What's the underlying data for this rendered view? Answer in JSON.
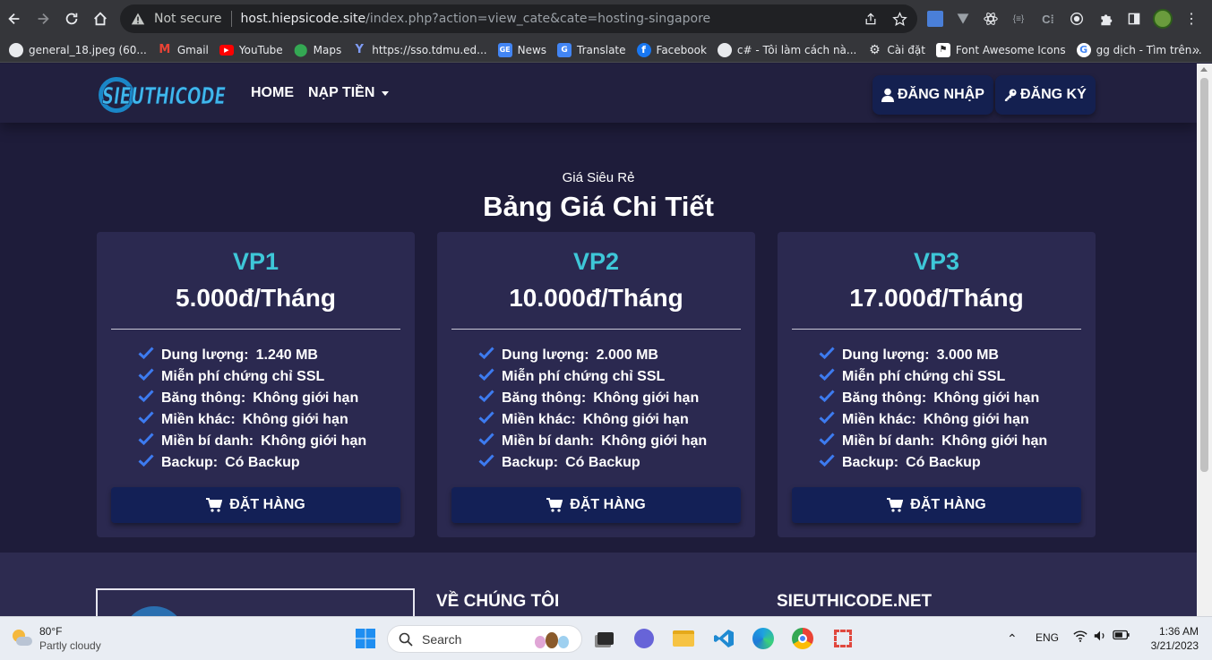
{
  "browser": {
    "security_label": "Not secure",
    "url_host": "host.hiepsicode.site",
    "url_path": "/index.php?action=view_cate&cate=hosting-singapore"
  },
  "bookmarks": [
    {
      "label": "general_18.jpeg (60...",
      "icon": "globe-icon",
      "color": "#5f6368"
    },
    {
      "label": "Gmail",
      "icon": "gmail-icon",
      "color": "#ea4335"
    },
    {
      "label": "YouTube",
      "icon": "youtube-icon",
      "color": "#ff0000"
    },
    {
      "label": "Maps",
      "icon": "maps-icon",
      "color": "#34a853"
    },
    {
      "label": "https://sso.tdmu.ed...",
      "icon": "tdmu-icon",
      "color": "#4a6fd8"
    },
    {
      "label": "News",
      "icon": "news-icon",
      "color": "#4285f4"
    },
    {
      "label": "Translate",
      "icon": "translate-icon",
      "color": "#4285f4"
    },
    {
      "label": "Facebook",
      "icon": "facebook-icon",
      "color": "#1877f2"
    },
    {
      "label": "c# - Tôi làm cách nà...",
      "icon": "globe-icon",
      "color": "#5f6368"
    },
    {
      "label": "Cài đặt",
      "icon": "gear-icon",
      "color": "#5f6368"
    },
    {
      "label": "Font Awesome Icons",
      "icon": "flag-icon",
      "color": "#222222"
    },
    {
      "label": "gg dịch - Tìm trên...",
      "icon": "google-icon",
      "color": "#4285f4"
    }
  ],
  "header": {
    "logo_text": "SIEUTHICODE",
    "nav": {
      "home": "HOME",
      "deposit": "NẠP TIỀN"
    },
    "login": "ĐĂNG NHẬP",
    "register": "ĐĂNG KÝ"
  },
  "pricing": {
    "eyebrow": "Giá Siêu Rẻ",
    "title": "Bảng Giá Chi Tiết",
    "order_label": "ĐẶT HÀNG",
    "plans": [
      {
        "name": "VP1",
        "price": "5.000đ/Tháng",
        "features": [
          {
            "label": "Dung lượng:",
            "value": "1.240 MB"
          },
          {
            "label": "Miễn phí chứng chỉ SSL",
            "value": ""
          },
          {
            "label": "Băng thông:",
            "value": "Không giới hạn"
          },
          {
            "label": "Miền khác:",
            "value": "Không giới hạn"
          },
          {
            "label": "Miền bí danh:",
            "value": "Không giới hạn"
          },
          {
            "label": "Backup:",
            "value": "Có Backup"
          }
        ]
      },
      {
        "name": "VP2",
        "price": "10.000đ/Tháng",
        "features": [
          {
            "label": "Dung lượng:",
            "value": "2.000 MB"
          },
          {
            "label": "Miễn phí chứng chỉ SSL",
            "value": ""
          },
          {
            "label": "Băng thông:",
            "value": "Không giới hạn"
          },
          {
            "label": "Miền khác:",
            "value": "Không giới hạn"
          },
          {
            "label": "Miền bí danh:",
            "value": "Không giới hạn"
          },
          {
            "label": "Backup:",
            "value": "Có Backup"
          }
        ]
      },
      {
        "name": "VP3",
        "price": "17.000đ/Tháng",
        "features": [
          {
            "label": "Dung lượng:",
            "value": "3.000 MB"
          },
          {
            "label": "Miễn phí chứng chỉ SSL",
            "value": ""
          },
          {
            "label": "Băng thông:",
            "value": "Không giới hạn"
          },
          {
            "label": "Miền khác:",
            "value": "Không giới hạn"
          },
          {
            "label": "Miền bí danh:",
            "value": "Không giới hạn"
          },
          {
            "label": "Backup:",
            "value": "Có Backup"
          }
        ]
      }
    ]
  },
  "footer": {
    "about_title": "VỀ CHÚNG TÔI",
    "site_title": "SIEUTHICODE.NET"
  },
  "taskbar": {
    "temperature": "80°F",
    "weather": "Partly cloudy",
    "search_placeholder": "Search",
    "language": "ENG",
    "time": "1:36 AM",
    "date": "3/21/2023"
  },
  "colors": {
    "page_bg": "#1e1c3a",
    "card_bg": "#2b2950",
    "plan_accent": "#3ec7d8",
    "button_bg": "#132056",
    "check_color": "#3d7bf0"
  }
}
